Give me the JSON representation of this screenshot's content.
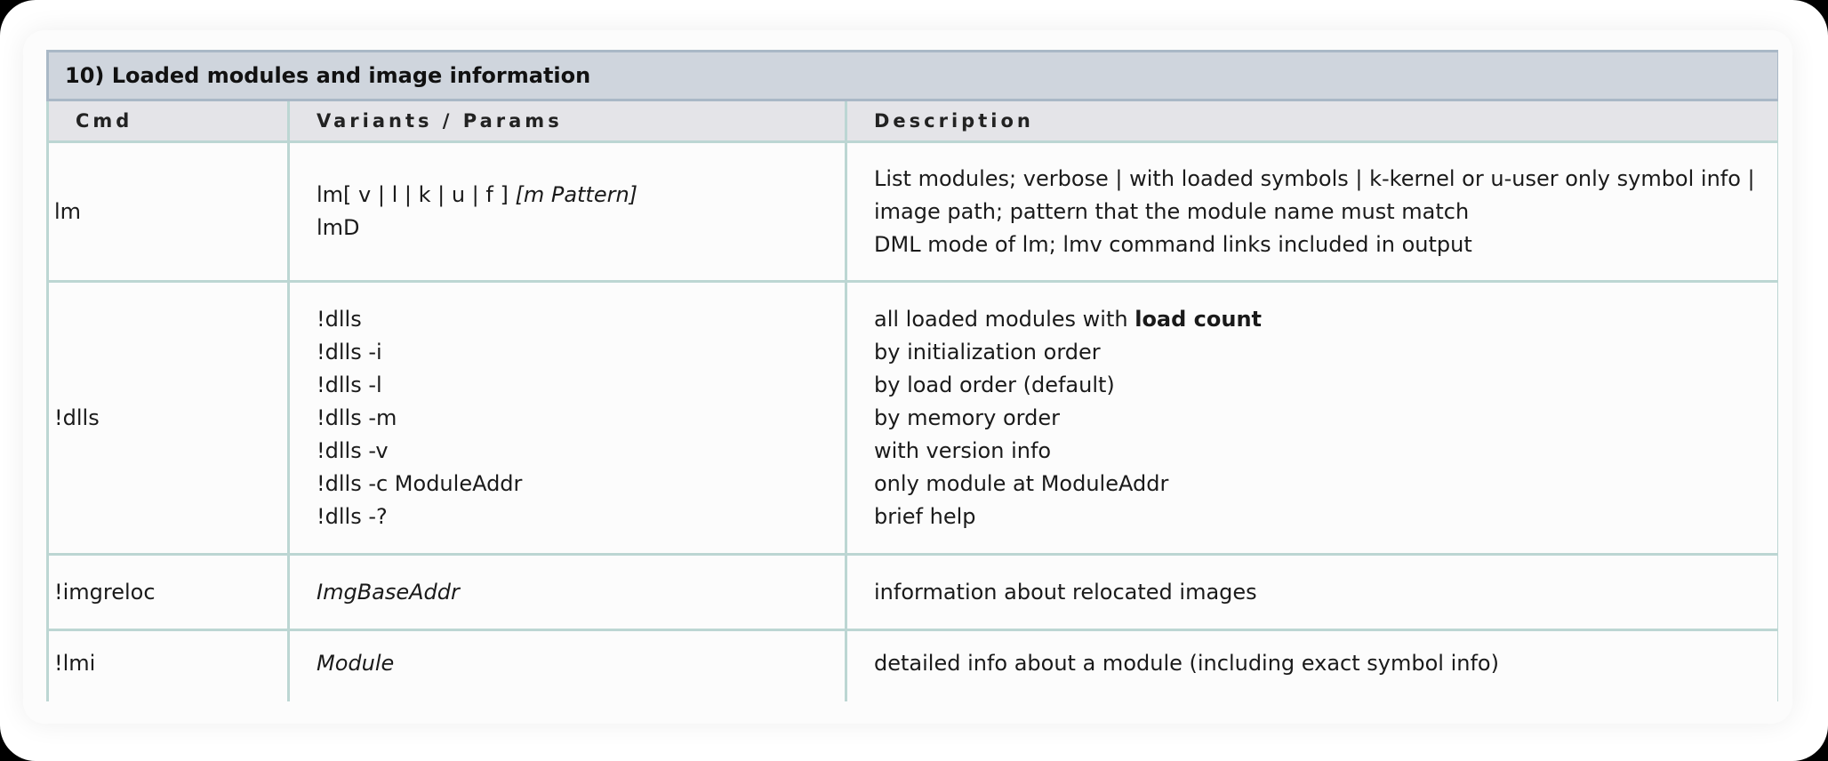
{
  "section": {
    "title": "10) Loaded modules and image information"
  },
  "columns": {
    "cmd": "Cmd",
    "variants": "Variants / Params",
    "description": "Description"
  },
  "rows": [
    {
      "cmd": "lm",
      "variants": [
        {
          "text": "lm[ v | l | k | u | f ] ",
          "italic_suffix": "[m Pattern]"
        },
        {
          "text": "lmD"
        }
      ],
      "description": [
        "List modules; verbose | with loaded symbols | k-kernel or u-user only symbol info |",
        "image path; pattern that the module name must match",
        "DML mode of lm; lmv command links included in output"
      ]
    },
    {
      "cmd": "!dlls",
      "variants": [
        "!dlls",
        "!dlls -i",
        "!dlls -l",
        "!dlls -m",
        "!dlls -v",
        "!dlls -c ModuleAddr",
        "!dlls -?"
      ],
      "description_first_prefix": "all loaded modules with ",
      "description_first_bold": "load count",
      "description": [
        "by initialization order",
        "by load order (default)",
        "by memory order",
        "with version info",
        "only module at ModuleAddr",
        "brief help"
      ]
    },
    {
      "cmd": "!imgreloc",
      "variants": "ImgBaseAddr",
      "description": "information about relocated images"
    },
    {
      "cmd": "!lmi",
      "variants": "Module",
      "description": "detailed info about a module (including exact symbol info)"
    }
  ]
}
